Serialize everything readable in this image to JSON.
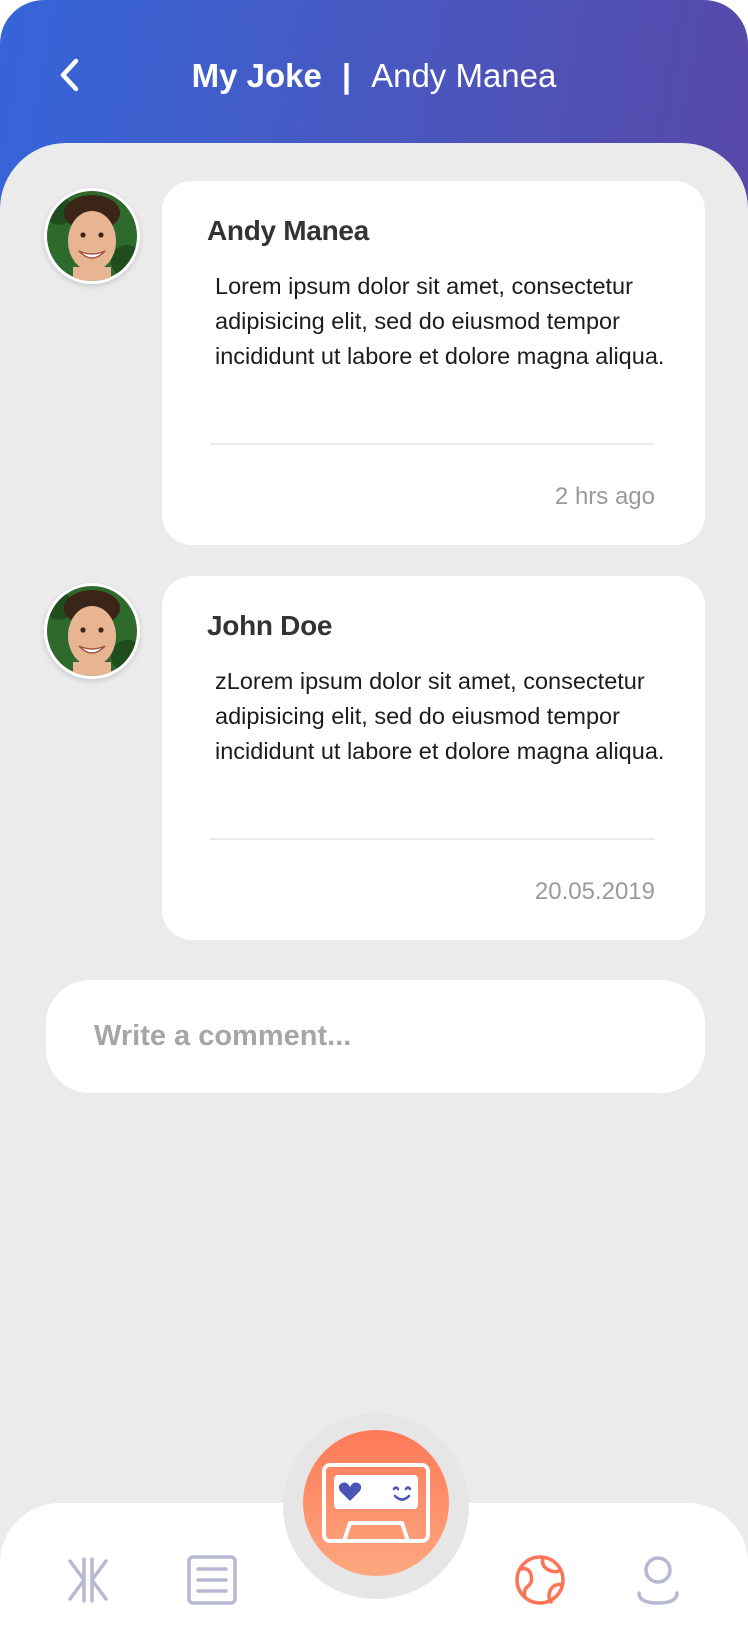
{
  "header": {
    "title": "My Joke",
    "separator": "|",
    "subtitle": "Andy Manea",
    "back_icon": "chevron-left-icon"
  },
  "comments": [
    {
      "author": "Andy Manea",
      "text": "Lorem ipsum dolor sit amet, consectetur adipisicing elit, sed do eiusmod tempor incididunt ut labore et dolore magna aliqua.",
      "time": "2 hrs ago"
    },
    {
      "author": "John Doe",
      "text": "zLorem ipsum dolor sit amet, consectetur adipisicing elit, sed do eiusmod tempor incididunt ut labore et dolore magna aliqua.",
      "time": "20.05.2019"
    }
  ],
  "comment_input": {
    "placeholder": "Write a comment...",
    "value": ""
  },
  "tabbar": {
    "items": [
      {
        "icon": "logo-icon",
        "active": false
      },
      {
        "icon": "list-icon",
        "active": false
      },
      {
        "icon": "cassette-icon",
        "active": true
      },
      {
        "icon": "globe-icon",
        "active": true
      },
      {
        "icon": "profile-icon",
        "active": false
      }
    ]
  },
  "colors": {
    "header_gradient_start": "#3565d9",
    "header_gradient_end": "#5748a8",
    "accent": "#fe7957",
    "inactive_icon": "#b7b9d3",
    "background": "#ebebeb"
  }
}
